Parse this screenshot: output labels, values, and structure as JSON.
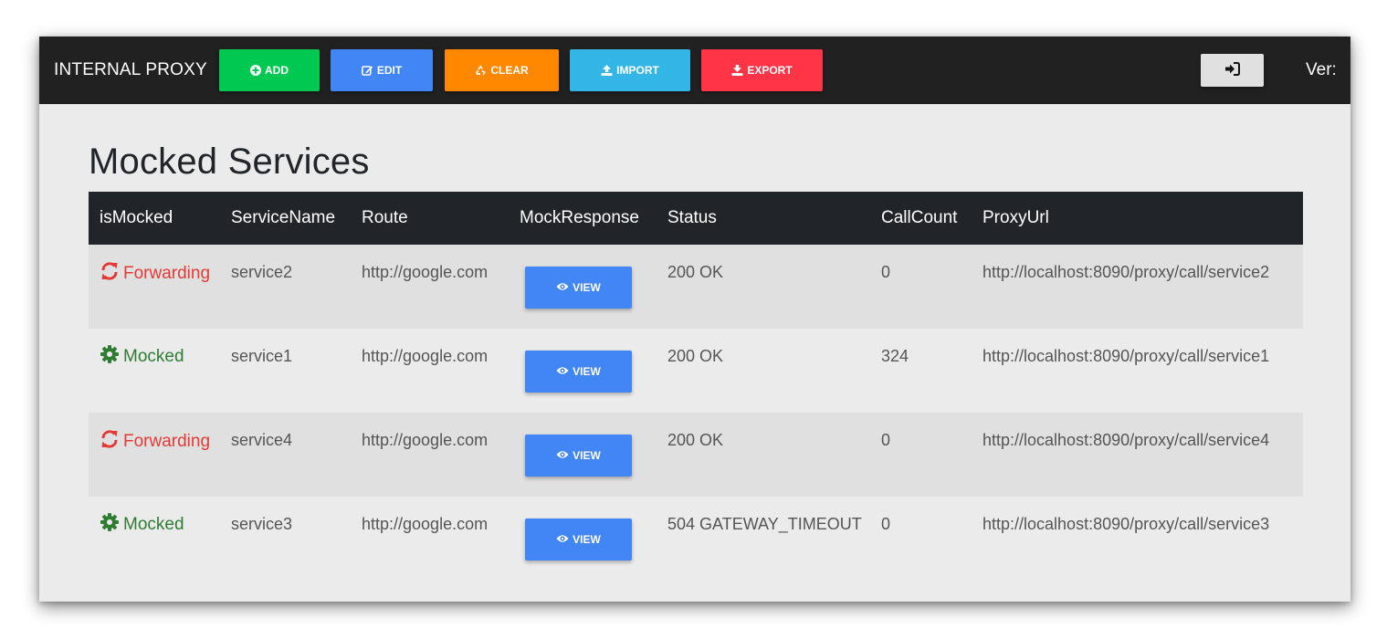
{
  "header": {
    "brand": "INTERNAL PROXY",
    "buttons": {
      "add": "ADD",
      "edit": "EDIT",
      "clear": "CLEAR",
      "import": "IMPORT",
      "export": "EXPORT"
    },
    "login_icon": "sign-in-icon",
    "version_label": "Ver:"
  },
  "page_title": "Mocked Services",
  "table": {
    "columns": [
      "isMocked",
      "ServiceName",
      "Route",
      "MockResponse",
      "Status",
      "CallCount",
      "ProxyUrl"
    ],
    "view_label": "VIEW",
    "rows": [
      {
        "state": "Forwarding",
        "service_name": "service2",
        "route": "http://google.com",
        "status": "200 OK",
        "call_count": "0",
        "proxy_url": "http://localhost:8090/proxy/call/service2"
      },
      {
        "state": "Mocked",
        "service_name": "service1",
        "route": "http://google.com",
        "status": "200 OK",
        "call_count": "324",
        "proxy_url": "http://localhost:8090/proxy/call/service1"
      },
      {
        "state": "Forwarding",
        "service_name": "service4",
        "route": "http://google.com",
        "status": "200 OK",
        "call_count": "0",
        "proxy_url": "http://localhost:8090/proxy/call/service4"
      },
      {
        "state": "Mocked",
        "service_name": "service3",
        "route": "http://google.com",
        "status": "504 GATEWAY_TIMEOUT",
        "call_count": "0",
        "proxy_url": "http://localhost:8090/proxy/call/service3"
      }
    ]
  },
  "colors": {
    "navbar": "#212121",
    "add": "#00c851",
    "edit": "#4285f4",
    "clear": "#ff8800",
    "import": "#33b5e5",
    "export": "#ff3547",
    "forwarding": "#e53935",
    "mocked": "#2e7d32"
  }
}
